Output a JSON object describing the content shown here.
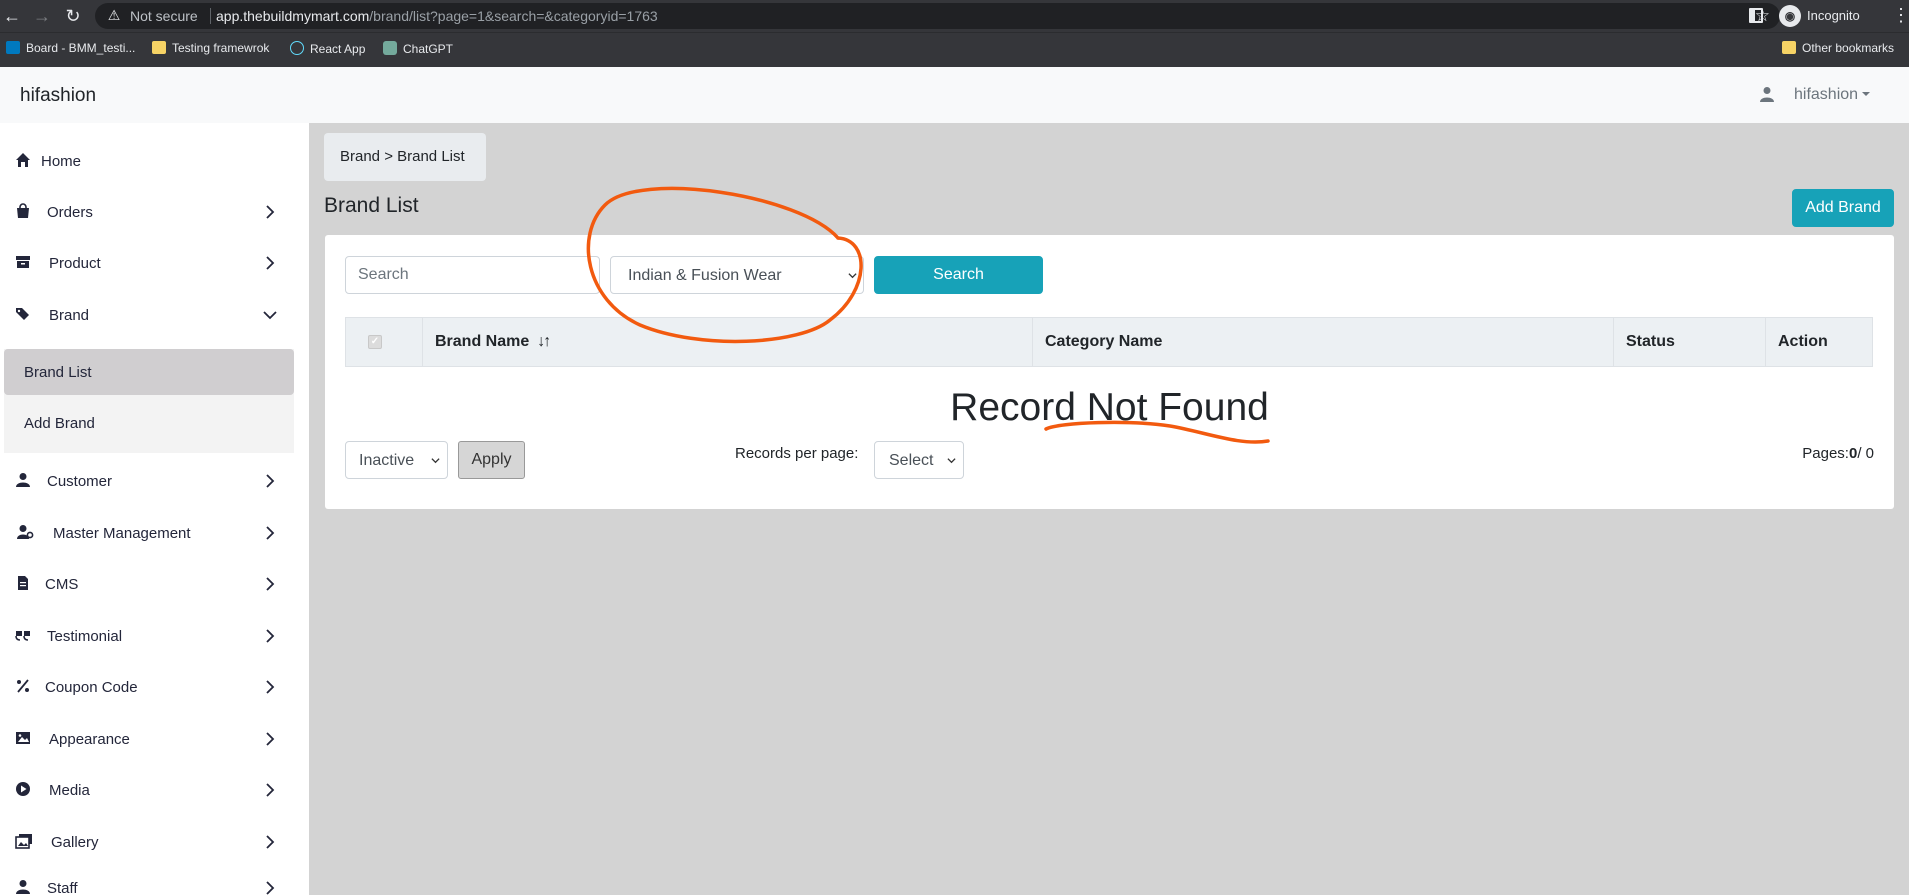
{
  "browser": {
    "security_label": "Not secure",
    "url_host": "app.thebuildmymart.com",
    "url_path": "/brand/list?page=1&search=&categoryid=1763",
    "incognito_label": "Incognito",
    "bookmarks": [
      {
        "label": "Board - BMM_testi...",
        "icon": "trello-icon"
      },
      {
        "label": "Testing framewrok",
        "icon": "folder-icon"
      },
      {
        "label": "React App",
        "icon": "react-icon"
      },
      {
        "label": "ChatGPT",
        "icon": "chatgpt-icon"
      }
    ],
    "other_bookmarks": "Other bookmarks"
  },
  "header": {
    "app_name": "hifashion",
    "user_name": "hifashion"
  },
  "sidebar": {
    "items": [
      {
        "label": "Home",
        "icon": "home-icon"
      },
      {
        "label": "Orders",
        "icon": "bag-icon"
      },
      {
        "label": "Product",
        "icon": "archive-icon"
      },
      {
        "label": "Brand",
        "icon": "tags-icon"
      },
      {
        "label": "Customer",
        "icon": "user-icon"
      },
      {
        "label": "Master Management",
        "icon": "user-gear-icon"
      },
      {
        "label": "CMS",
        "icon": "file-icon"
      },
      {
        "label": "Testimonial",
        "icon": "quote-icon"
      },
      {
        "label": "Coupon Code",
        "icon": "percent-icon"
      },
      {
        "label": "Appearance",
        "icon": "image-icon"
      },
      {
        "label": "Media",
        "icon": "play-circle-icon"
      },
      {
        "label": "Gallery",
        "icon": "images-icon"
      },
      {
        "label": "Staff",
        "icon": "user-icon"
      }
    ],
    "brand_submenu": [
      {
        "label": "Brand List",
        "active": true
      },
      {
        "label": "Add Brand",
        "active": false
      }
    ]
  },
  "main": {
    "breadcrumb": "Brand > Brand List",
    "page_title": "Brand List",
    "add_button": "Add Brand",
    "search_placeholder": "Search",
    "category_selected": "Indian & Fusion Wear",
    "search_button": "Search",
    "table_headers": [
      "Brand Name",
      "Category Name",
      "Status",
      "Action"
    ],
    "sort_icon": "↓↑",
    "empty_message": "Record Not Found",
    "status_selected": "Inactive",
    "apply_button": "Apply",
    "records_per_page_label": "Records per page:",
    "records_per_page_selected": "Select",
    "pages_label": "Pages:",
    "pages_current": "0",
    "pages_total": "/ 0"
  },
  "colors": {
    "accent": "#17a2b8",
    "annotation": "#f25a0f",
    "page_bg": "#d3d3d3"
  }
}
